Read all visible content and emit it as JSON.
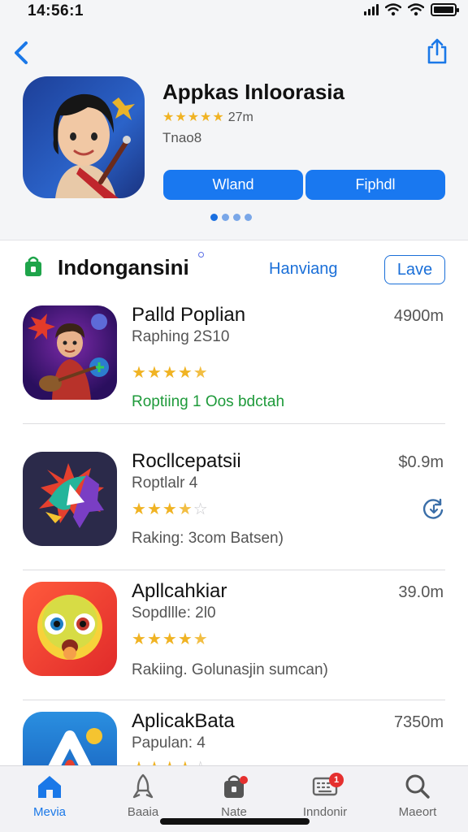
{
  "status_bar": {
    "time": "14:56:1"
  },
  "hero": {
    "title": "Appkas Inloorasia",
    "rating_stars": "★★★★★",
    "rating_text": "27m",
    "subtitle": "Tnao8",
    "button_primary": "Wland",
    "button_secondary": "Fiphdl",
    "pager_count": 4,
    "pager_active": 0
  },
  "section": {
    "title": "Indongansini",
    "link": "Hanviang",
    "button": "Lave"
  },
  "apps": [
    {
      "name": "Palld Poplian",
      "subtitle": "Raphing 2S10",
      "rating": 4.5,
      "footer": "Roptiing  1 Oos bdctah",
      "footer_color": "#1e9a3a",
      "size": "4900m",
      "action_icon": ""
    },
    {
      "name": "Rocllcepatsii",
      "subtitle": "Roptlalr 4",
      "rating": 3.5,
      "footer": "Raking: 3com Batsen)",
      "footer_color": "#555555",
      "size": "$0.9m",
      "action_icon": "refresh-download-icon"
    },
    {
      "name": "Apllcahkiar",
      "subtitle": "Sopdllle: 2l0",
      "rating": 4.5,
      "footer": "Rakiing. Golunasjin sumcan)",
      "footer_color": "#555555",
      "size": "39.0m",
      "action_icon": ""
    },
    {
      "name": "AplicakBata",
      "subtitle": "Papulan: 4",
      "rating": 4,
      "footer": "",
      "footer_color": "#555555",
      "size": "7350m",
      "action_icon": ""
    }
  ],
  "tab_bar": {
    "tabs": [
      {
        "label": "Mevia",
        "icon": "home-icon",
        "active": true,
        "badge": ""
      },
      {
        "label": "Baaia",
        "icon": "rocket-icon",
        "active": false,
        "badge": ""
      },
      {
        "label": "Nate",
        "icon": "bag-icon",
        "active": false,
        "badge": "dot"
      },
      {
        "label": "Inndonir",
        "icon": "keyboard-icon",
        "active": false,
        "badge": "1"
      },
      {
        "label": "Maeort",
        "icon": "search-icon",
        "active": false,
        "badge": ""
      }
    ]
  },
  "colors": {
    "accent": "#1978f0",
    "star": "#f0b323",
    "green": "#1e9a3a",
    "badge": "#e5302f"
  }
}
